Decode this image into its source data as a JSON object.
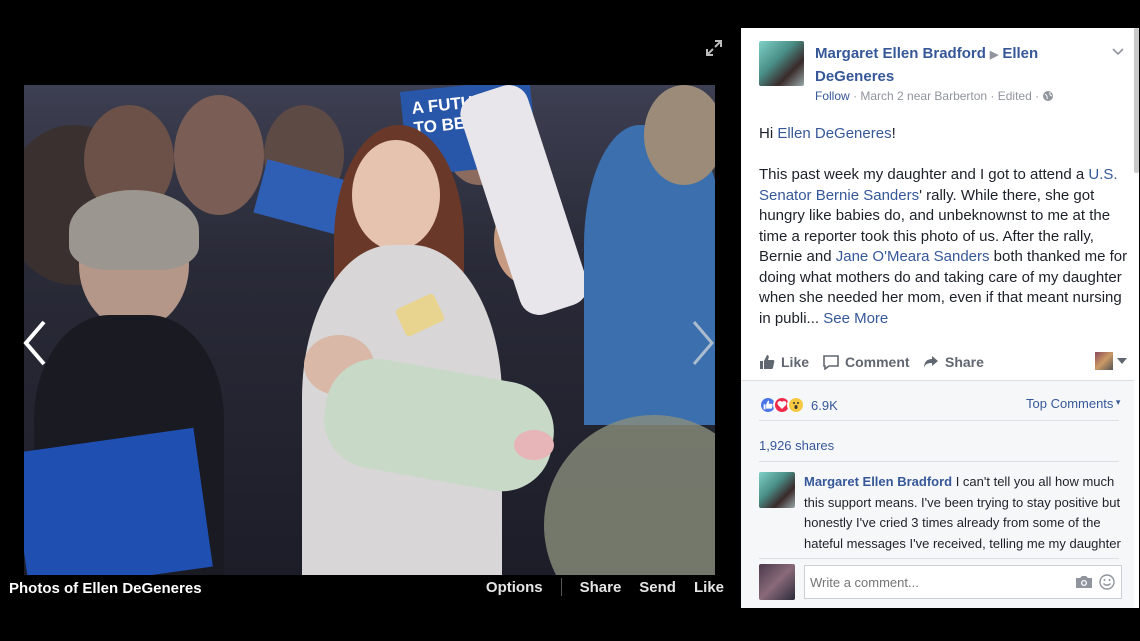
{
  "viewer": {
    "album_title": "Photos of Ellen DeGeneres",
    "actions": [
      "Options",
      "Share",
      "Send",
      "Like"
    ],
    "photo_sign_text": "A FUTURE TO BELIEVE"
  },
  "post": {
    "author": "Margaret Ellen Bradford",
    "target": "Ellen DeGeneres",
    "follow": "Follow",
    "meta": "· March 2 near Barberton · Edited ·",
    "greeting_prefix": "Hi ",
    "greeting_link": "Ellen DeGeneres",
    "greeting_suffix": "!",
    "p1_a": "This past week my daughter and I got to attend a ",
    "p1_link1": "U.S. Senator Bernie Sanders",
    "p1_b": "' rally. While there, she got hungry like babies do, and unbeknownst to me at the time a reporter took this photo of us. After the rally, Bernie and ",
    "p1_link2": "Jane O'Meara Sanders",
    "p1_c": " both thanked me for doing what mothers do and taking care of my daughter when she needed her mom, even if that meant nursing in publi...",
    "see_more": "See More"
  },
  "post_actions": {
    "like": "Like",
    "comment": "Comment",
    "share": "Share"
  },
  "reactions": {
    "count": "6.9K",
    "top_comments": "Top Comments",
    "shares": "1,926 shares"
  },
  "comment": {
    "author": "Margaret Ellen Bradford",
    "text": " I can't tell you all how much this support means. I've been trying to stay positive but honestly I've cried 3 times already from some of the hateful messages I've received, telling me my daughter should be taken or that I'm just an"
  },
  "composer": {
    "placeholder": "Write a comment..."
  },
  "colors": {
    "link": "#365899",
    "meta": "#90949c",
    "panel_bg": "#ffffff",
    "viewer_bg": "#000000"
  },
  "icons": [
    "expand-icon",
    "chevron-left-icon",
    "chevron-right-icon",
    "chevron-down-icon",
    "globe-icon",
    "like-icon",
    "comment-icon",
    "share-icon",
    "camera-icon",
    "smiley-icon"
  ]
}
